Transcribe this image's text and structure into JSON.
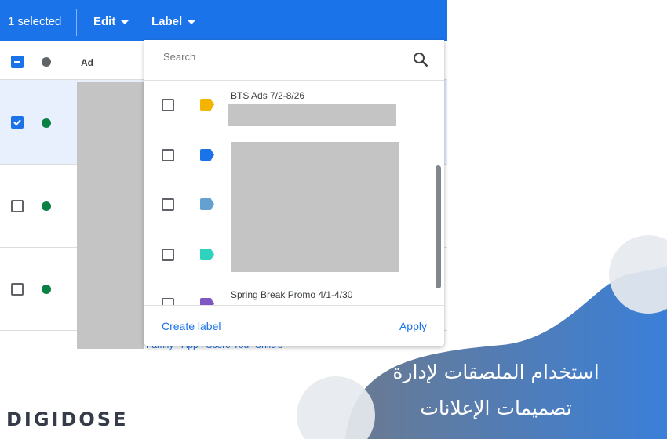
{
  "toolbar": {
    "selected": "1 selected",
    "edit": "Edit",
    "label": "Label"
  },
  "table": {
    "header": {
      "ad": "Ad"
    },
    "rows": [
      {
        "checked": true,
        "status": "green"
      },
      {
        "checked": false,
        "status": "green"
      },
      {
        "checked": false,
        "status": "green"
      }
    ],
    "footer_text": "Family · App | Score Your Child's"
  },
  "dropdown": {
    "search_placeholder": "Search",
    "items": [
      {
        "name": "BTS Ads 7/2-8/26",
        "color": "#f4b400"
      },
      {
        "name": "",
        "color": "#1a73e8"
      },
      {
        "name": "",
        "color": "#64a0d0"
      },
      {
        "name": "",
        "color": "#2ed3c0"
      },
      {
        "name": "Spring Break Promo 4/1-4/30",
        "color": "#7e57c2"
      }
    ],
    "create": "Create label",
    "apply": "Apply"
  },
  "banner": {
    "title_line1": "استخدام الملصقات لإدارة",
    "title_line2": "تصميمات الإعلانات"
  },
  "logo": "DIGIDOSE",
  "colors": {
    "accent": "#1a73e8",
    "status_green": "#0b8043"
  }
}
